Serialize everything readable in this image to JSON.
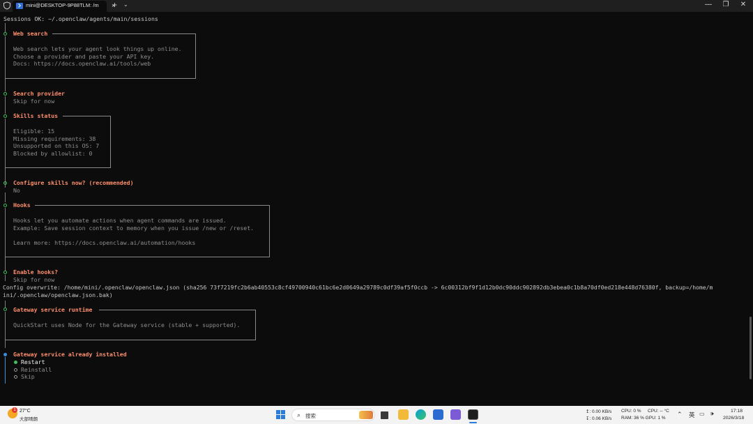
{
  "window": {
    "tab_title": "mini@DESKTOP-9P88TLM: /m",
    "tab_close": "×",
    "new_tab": "+",
    "dropdown": "⌄",
    "minimize": "—",
    "maximize": "❐",
    "close": "✕"
  },
  "terminal": {
    "sessions_line": "Sessions OK: ~/.openclaw/agents/main/sessions",
    "web_search": {
      "title": "Web search",
      "lines": [
        "Web search lets your agent look things up online.",
        "Choose a provider and paste your API key.",
        "Docs: https://docs.openclaw.ai/tools/web"
      ]
    },
    "search_provider": {
      "title": "Search provider",
      "value": "Skip for now"
    },
    "skills_status": {
      "title": "Skills status",
      "lines": [
        "Eligible: 15",
        "Missing requirements: 38",
        "Unsupported on this OS: 7",
        "Blocked by allowlist: 0"
      ]
    },
    "configure_skills": {
      "title": "Configure skills now? (recommended)",
      "value": "No"
    },
    "hooks": {
      "title": "Hooks",
      "lines": [
        "Hooks let you automate actions when agent commands are issued.",
        "Example: Save session context to memory when you issue /new or /reset.",
        "",
        "Learn more: https://docs.openclaw.ai/automation/hooks"
      ]
    },
    "enable_hooks": {
      "title": "Enable hooks?",
      "value": "Skip for now"
    },
    "config_overwrite": [
      "Config overwrite: /home/mini/.openclaw/openclaw.json (sha256 73f7219fc2b6ab40553c8cf49700940c61bc6e2d0649a29789c0df39af5f0ccb -> 6c00312bf9f1d12b0dc90ddc902892db3ebea0c1b8a70df0ed218e448d76380f, backup=/home/m",
      "ini/.openclaw/openclaw.json.bak)"
    ],
    "gateway_runtime": {
      "title": "Gateway service runtime",
      "text": "QuickStart uses Node for the Gateway service (stable + supported)."
    },
    "gateway_installed": {
      "title": "Gateway service already installed",
      "options": [
        "Restart",
        "Reinstall",
        "Skip"
      ],
      "selected": "Restart"
    }
  },
  "taskbar": {
    "weather_badge": "1",
    "weather_temp": "27°C",
    "weather_desc": "大部晴朗",
    "search_placeholder": "搜索",
    "net_up": "↥: 0.00 KB/s",
    "net_down": "↧: 0.06 KB/s",
    "cpu": "CPU: 0 %",
    "cpu_temp": "CPU: -- °C",
    "ram_gpu": "RAM: 36 % GPU: 1 %",
    "lang": "英",
    "time": "17:18",
    "date": "2026/3/18"
  },
  "colors": {
    "terminal_bg": "#0c0c0c",
    "header": "#ff8f6d",
    "prompt_dot": "#3fbf5f",
    "active_dot": "#3a8fd8"
  }
}
